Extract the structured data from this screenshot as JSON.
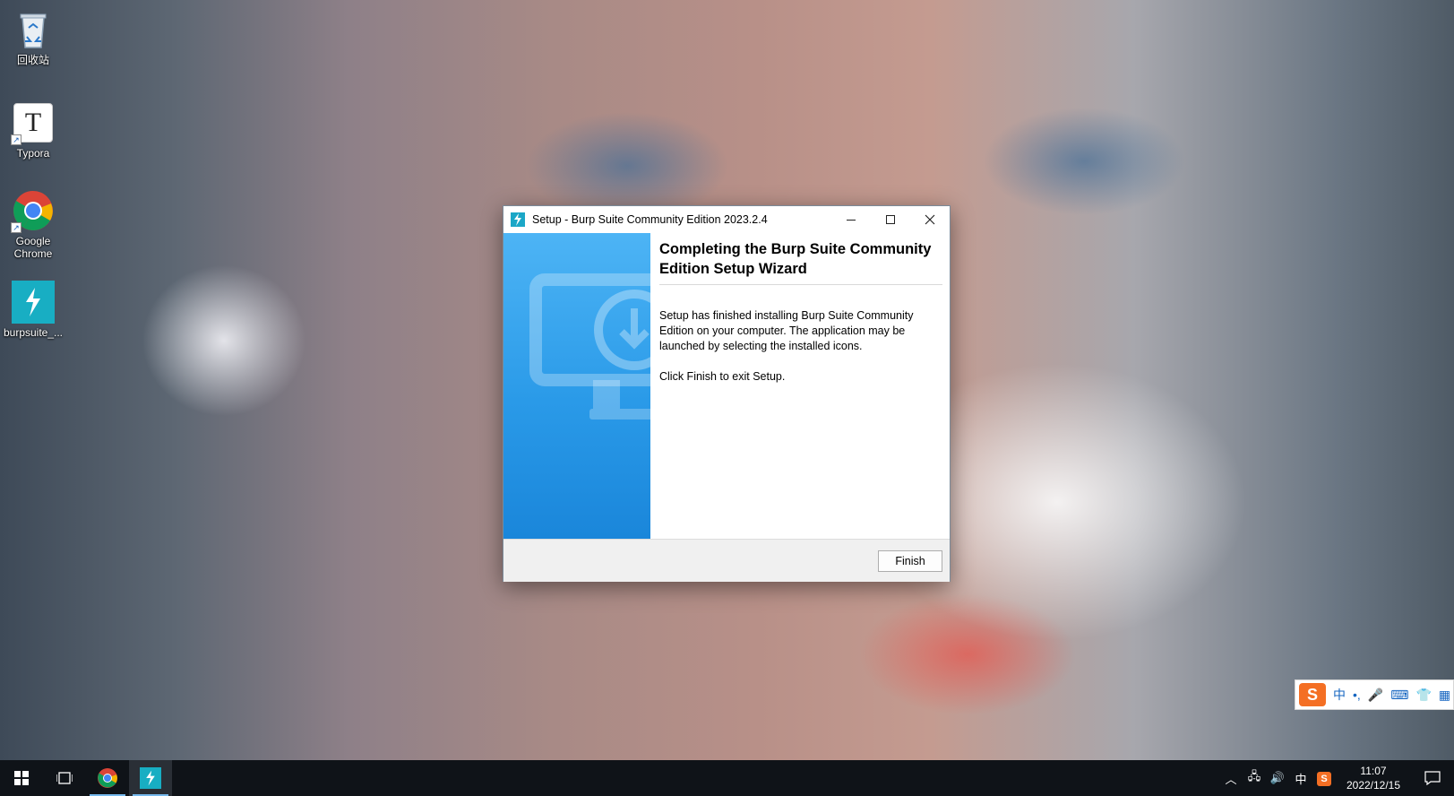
{
  "desktop": {
    "icons": [
      {
        "label": "回收站",
        "icon": "recycle-bin-icon"
      },
      {
        "label": "Typora",
        "icon": "typora-icon",
        "glyph": "T"
      },
      {
        "label": "Google Chrome",
        "icon": "chrome-icon"
      },
      {
        "label": "burpsuite_...",
        "icon": "burpsuite-icon"
      }
    ]
  },
  "dialog": {
    "title": "Setup - Burp Suite Community Edition 2023.2.4",
    "heading": "Completing the Burp Suite Community Edition Setup Wizard",
    "body": "Setup has finished installing Burp Suite Community Edition on your computer. The application may be launched by selecting the installed icons.",
    "body2": "Click Finish to exit Setup.",
    "finish_label": "Finish",
    "accent": "#1ba7c7"
  },
  "ime": {
    "logo": "S",
    "mode": "中",
    "punct": "•,"
  },
  "taskbar": {
    "tray": {
      "ime_mode": "中",
      "time": "11:07",
      "date": "2022/12/15"
    }
  }
}
